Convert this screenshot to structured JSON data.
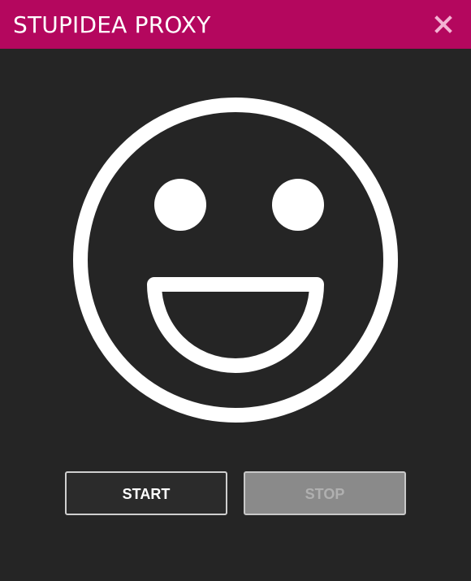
{
  "window": {
    "title": "STUPIDEA PROXY",
    "close_icon": "close-icon",
    "accent_color": "#b4075e",
    "background_color": "#252525"
  },
  "status": {
    "icon": "smiley-face-icon",
    "mood": "happy"
  },
  "controls": {
    "start_label": "START",
    "stop_label": "STOP",
    "stop_enabled": false
  }
}
